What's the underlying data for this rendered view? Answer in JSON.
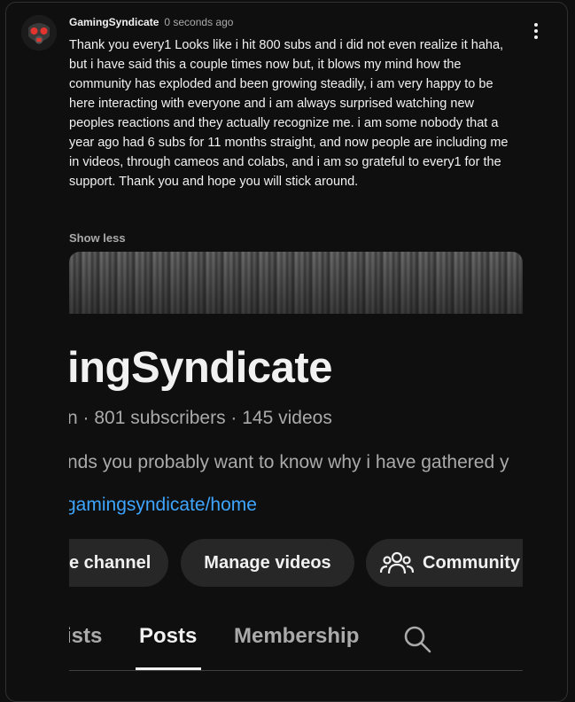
{
  "post": {
    "author": "GamingSyndicate",
    "time": "0 seconds ago",
    "line1": "Thank you every1 Looks like i hit 800 subs and i did not even realize it haha,",
    "line2": "but i have said this a couple times now but, it blows my mind how the community has exploded and been growing steadily, i am very happy to be here interacting with everyone and i am always surprised watching new peoples reactions and they actually recognize me. i am some nobody that a year ago had 6 subs for 11 months straight, and now people are including me in videos, through cameos and colabs, and i am so grateful to every1 for the support. Thank you and hope you will stick around.",
    "show_less": "Show less"
  },
  "attached_image": {
    "channel_title": "ingSyndicate",
    "meta": "n · 801 subscribers · 145 videos",
    "description": "nds you probably want to know why i have gathered y",
    "link": "gamingsyndicate/home",
    "buttons": {
      "customize": "e channel",
      "manage": "Manage videos",
      "community": "Community"
    },
    "tabs": {
      "playlists": "ists",
      "posts": "Posts",
      "membership": "Membership"
    },
    "active_tab": "Posts"
  },
  "icons": {
    "menu": "more-vert-icon",
    "community": "people-icon",
    "search": "search-icon"
  },
  "colors": {
    "background": "#0f0f0f",
    "link": "#3ea6ff",
    "pill": "#272727",
    "avatar_accent": "#e3342f"
  }
}
